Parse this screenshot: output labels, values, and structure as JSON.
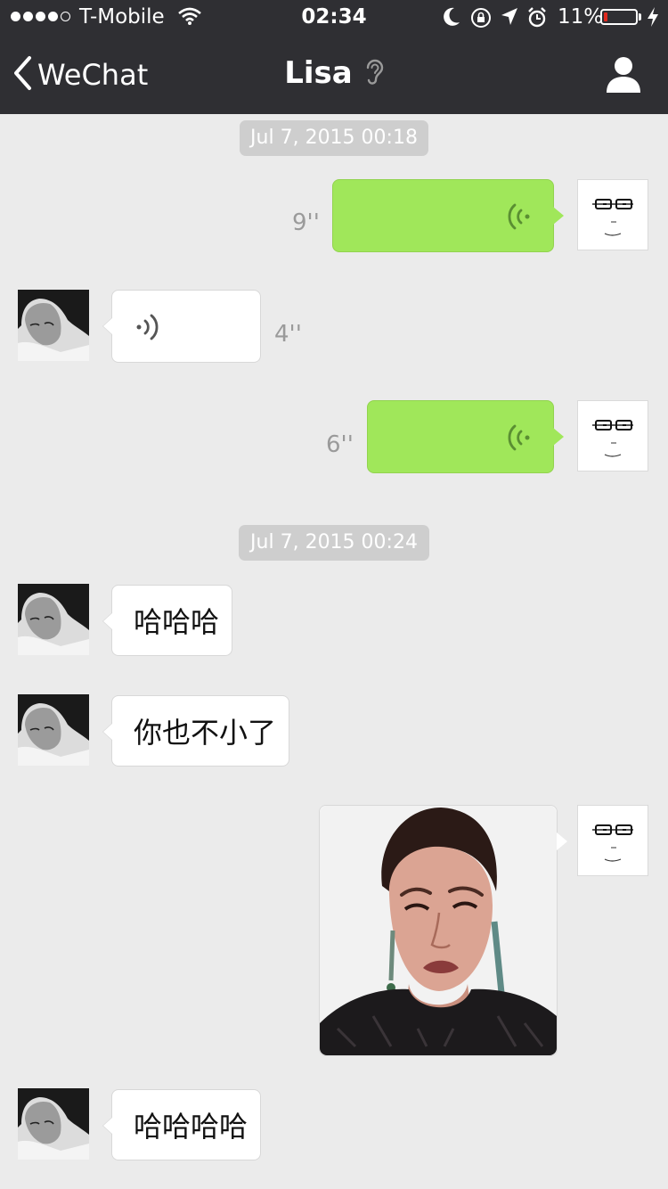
{
  "status_bar": {
    "carrier": "T-Mobile",
    "time": "02:34",
    "battery_percent": "11%",
    "battery_level": 0.11,
    "signal_bars": 4,
    "colors": {
      "battery_low": "#e0291f"
    }
  },
  "nav": {
    "back_label": "WeChat",
    "title": "Lisa",
    "icons": [
      "chevron-left-icon",
      "ear-icon",
      "person-icon"
    ]
  },
  "chat": {
    "colors": {
      "background": "#ebebeb",
      "outgoing_bubble": "#a0e75a",
      "incoming_bubble": "#ffffff",
      "timestamp_bg": "#cecece"
    },
    "timestamps": [
      "Jul 7, 2015 00:18",
      "Jul 7, 2015 00:24"
    ],
    "messages": [
      {
        "from": "me",
        "type": "voice",
        "duration": "9''"
      },
      {
        "from": "Lisa",
        "type": "voice",
        "duration": "4''"
      },
      {
        "from": "me",
        "type": "voice",
        "duration": "6''"
      },
      {
        "from": "Lisa",
        "type": "text",
        "text": "哈哈哈"
      },
      {
        "from": "Lisa",
        "type": "text",
        "text": "你也不小了"
      },
      {
        "from": "me",
        "type": "image",
        "description": "sticker-photo"
      },
      {
        "from": "Lisa",
        "type": "text",
        "text": "哈哈哈哈"
      }
    ]
  }
}
